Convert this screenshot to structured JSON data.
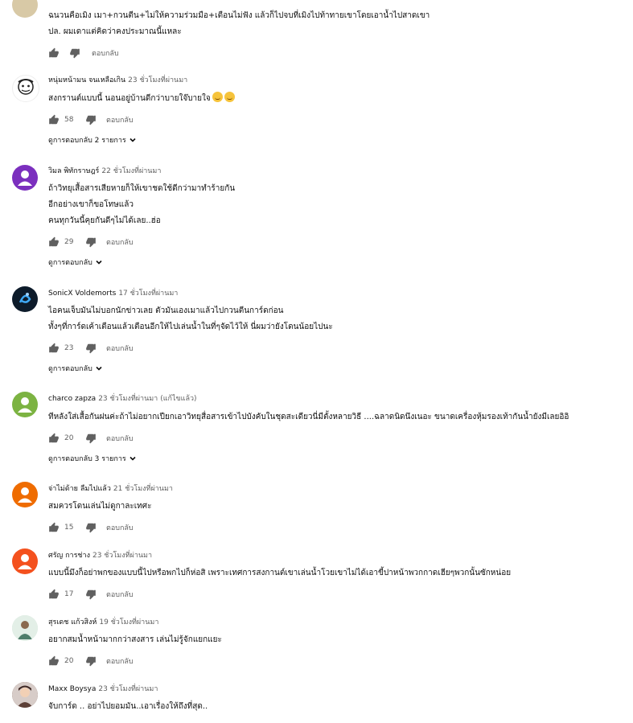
{
  "labels": {
    "reply": "ตอบกลับ"
  },
  "comments": [
    {
      "author": "",
      "time": "",
      "lines": [
        "ฉนวนคือเมิง เมา+กวนตีน+ไม่ให้ความร่วมมือ+เตือนไม่ฟัง แล้วก็ไปจบที่เมิงไปท้าทายเขาโดยเอาน้ำไปสาดเขา",
        "ปล. ผมเดาแต่คิดว่าคงประมาณนี้แหละ"
      ],
      "likes": "",
      "avatar_color": "#d8c9a6"
    },
    {
      "author": "หนุ่มหน้ามน จนเหลือเกิน",
      "time": "23 ชั่วโมงที่ผ่านมา",
      "lines": [
        "สงกรานต์แบบนี้ นอนอยู่บ้านดีกว่าบายใจ๊บายใจ"
      ],
      "likes": "58",
      "replies": "ดูการตอบกลับ 2 รายการ",
      "avatar_color": "#ffffff"
    },
    {
      "author": "วิมล พิทักราษฎร์",
      "time": "22 ชั่วโมงที่ผ่านมา",
      "lines": [
        "ถ้าวิทยุเสื้อสารเสียหายก็ให้เขาชดใช้ดีกว่ามาทำร้ายกัน",
        "อีกอย่างเขาก็ขอโทษแล้ว",
        "คนทุกวันนี้คุยกันดีๆไม่ได้เลย..ฮ่อ"
      ],
      "likes": "29",
      "replies": "ดูการตอบกลับ",
      "avatar_color": "#7b2fbe"
    },
    {
      "author": "SonicX Voldemorts",
      "time": "17 ชั่วโมงที่ผ่านมา",
      "lines": [
        "ไอคนเจ็บมันไม่บอกนักข่าวเลย ตัวมันเองเมาแล้วไปกวนตีนการ์ดก่อน",
        "ทั้งๆที่การ์ดเค้าเตือนแล้วเตือนอีกให้ไปเล่นน้ำในที่ๆจัดไว้ให้ นี่ผมว่ายังโดนน้อยไปนะ"
      ],
      "likes": "23",
      "replies": "ดูการตอบกลับ",
      "avatar_color": "#0d1b2a"
    },
    {
      "author": "charco zapza",
      "time": "23 ชั่วโมงที่ผ่านมา",
      "edited": "(แก้ไขแล้ว)",
      "lines": [
        "ทีหลังใส่เสื้อกันฝนค่ะถ้าไม่อยากเปียกเอาวิทยุสื่อสารเข้าไปบังคับในชุดสะเดียวนี่มีตั้งหลายวิธี ....ฉลาดนิดนึงเนอะ ขนาดเครื่องหุ้มรองเท้ากันน้ำยังมีเลยอิอิ"
      ],
      "likes": "20",
      "replies": "ดูการตอบกลับ 3 รายการ",
      "avatar_color": "#7cb342"
    },
    {
      "author": "จ่าไม่ด้าย ลืมไปแล้ว",
      "time": "21 ชั่วโมงที่ผ่านมา",
      "lines": [
        "สมควรโดนเล่นไม่ดูกาละเทศะ"
      ],
      "likes": "15",
      "avatar_color": "#ef6c00"
    },
    {
      "author": "ศรัญ การช่าง",
      "time": "23 ชั่วโมงที่ผ่านมา",
      "lines": [
        "แบบนี้มึงก็อย่าพกของแบบนี้ไปหรือพกไปก็ห่อสิ   เพราะเทศการสงกานต์เขาเล่นน้ำโวยเขาไม่ได้เอาขี้ปาหน้าพวกกาดเฮียๆพวกนั้นซักหน่อย"
      ],
      "likes": "17",
      "avatar_color": "#f4511e"
    },
    {
      "author": "สุรเดช แก้วสิงห์",
      "time": "19 ชั่วโมงที่ผ่านมา",
      "lines": [
        "อยากสมน้ำหน้ามากกว่าสงสาร เล่นไม่รู้จักแยกแยะ"
      ],
      "likes": "20",
      "avatar_color": "#cfe3d6"
    },
    {
      "author": "Maxx Boysya",
      "time": "23 ชั่วโมงที่ผ่านมา",
      "lines": [
        "จับการ์ด .. อย่าไปยอมมัน..เอาเรื่องให้ถึงที่สุด.."
      ],
      "likes": "",
      "avatar_color": "#6d4c41"
    }
  ]
}
